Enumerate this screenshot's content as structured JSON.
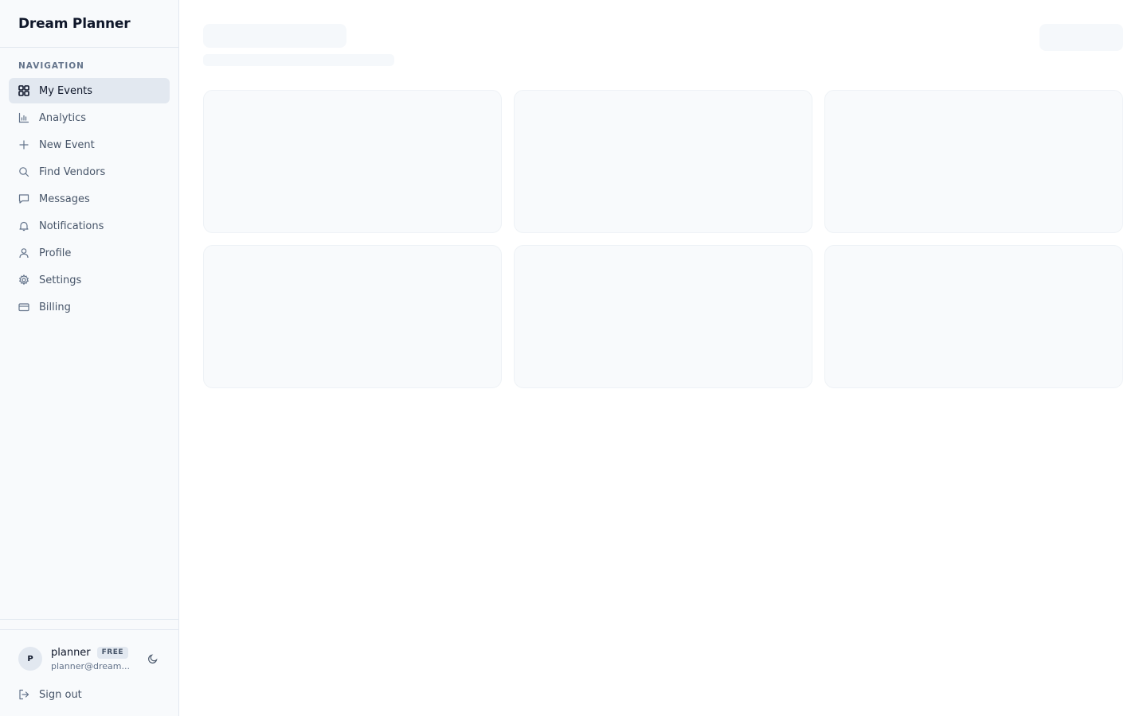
{
  "app": {
    "title": "Dream Planner"
  },
  "navigation": {
    "section_label": "NAVIGATION",
    "items": [
      {
        "label": "My Events",
        "icon": "grid-icon",
        "active": true
      },
      {
        "label": "Analytics",
        "icon": "bar-chart-icon",
        "active": false
      },
      {
        "label": "New Event",
        "icon": "plus-icon",
        "active": false
      },
      {
        "label": "Find Vendors",
        "icon": "search-icon",
        "active": false
      },
      {
        "label": "Messages",
        "icon": "message-icon",
        "active": false
      },
      {
        "label": "Notifications",
        "icon": "bell-icon",
        "active": false
      },
      {
        "label": "Profile",
        "icon": "user-icon",
        "active": false
      },
      {
        "label": "Settings",
        "icon": "gear-icon",
        "active": false
      },
      {
        "label": "Billing",
        "icon": "credit-card-icon",
        "active": false
      }
    ]
  },
  "user": {
    "avatar_initial": "P",
    "name": "planner",
    "plan": "FREE",
    "email": "planner@dream..."
  },
  "footer": {
    "sign_out_label": "Sign out",
    "theme_icon": "moon-icon"
  },
  "colors": {
    "sidebar_bg": "#f8fafc",
    "active_item_bg": "#e2e8f0",
    "skeleton": "#f1f5f9",
    "border": "#e2e8f0"
  }
}
